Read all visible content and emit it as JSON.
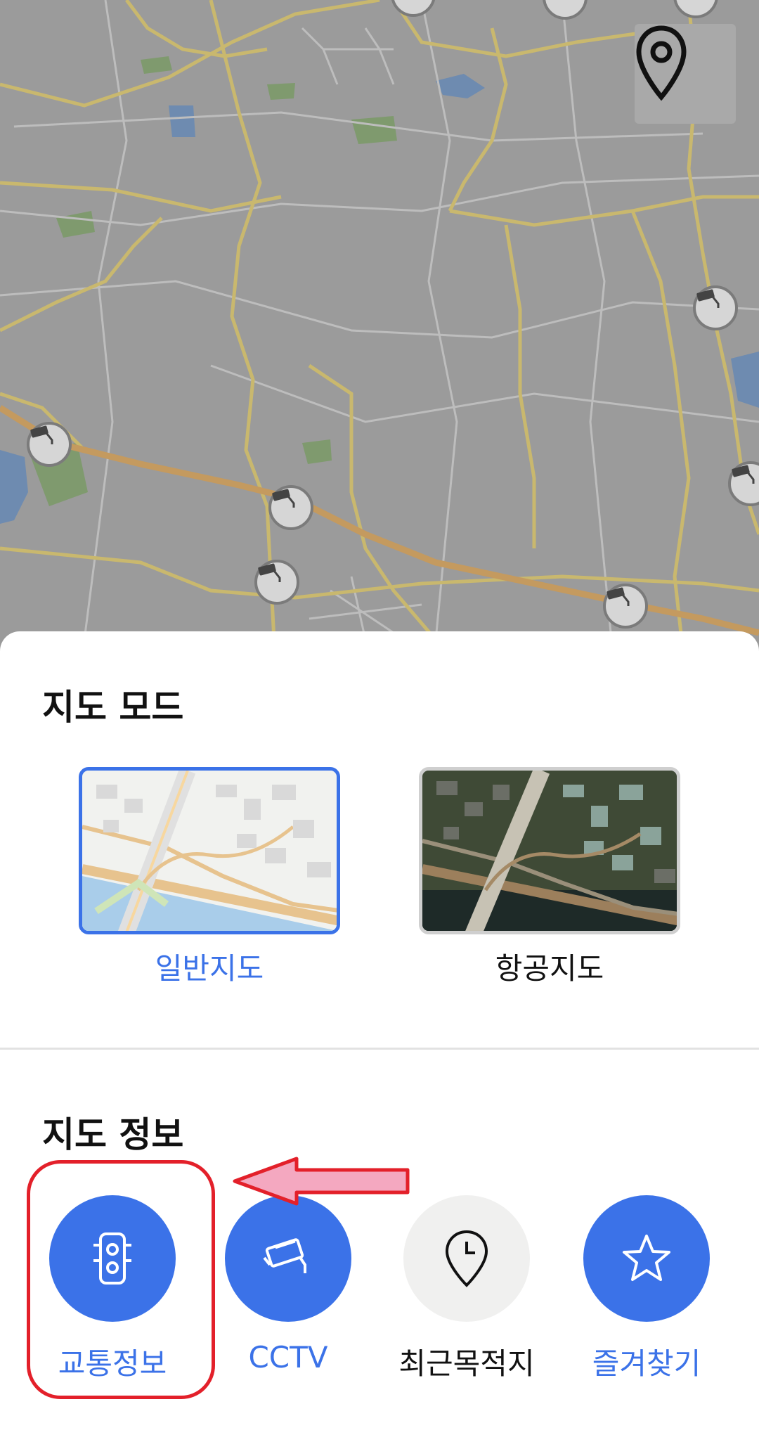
{
  "map": {
    "cctv_markers": 9,
    "location_button_icon": "location-pin-icon"
  },
  "sheet": {
    "map_mode_title": "지도 모드",
    "modes": [
      {
        "label": "일반지도",
        "selected": true
      },
      {
        "label": "항공지도",
        "selected": false
      }
    ],
    "map_info_title": "지도 정보",
    "info_items": [
      {
        "label": "교통정보",
        "icon": "traffic-light-icon",
        "active": true
      },
      {
        "label": "CCTV",
        "icon": "cctv-icon",
        "active": true
      },
      {
        "label": "최근목적지",
        "icon": "clock-pin-icon",
        "active": false
      },
      {
        "label": "즐겨찾기",
        "icon": "star-icon",
        "active": true
      }
    ]
  },
  "colors": {
    "accent": "#3b72e8",
    "annotation_red": "#e3202a",
    "annotation_arrow_fill": "#f4a8c0"
  }
}
